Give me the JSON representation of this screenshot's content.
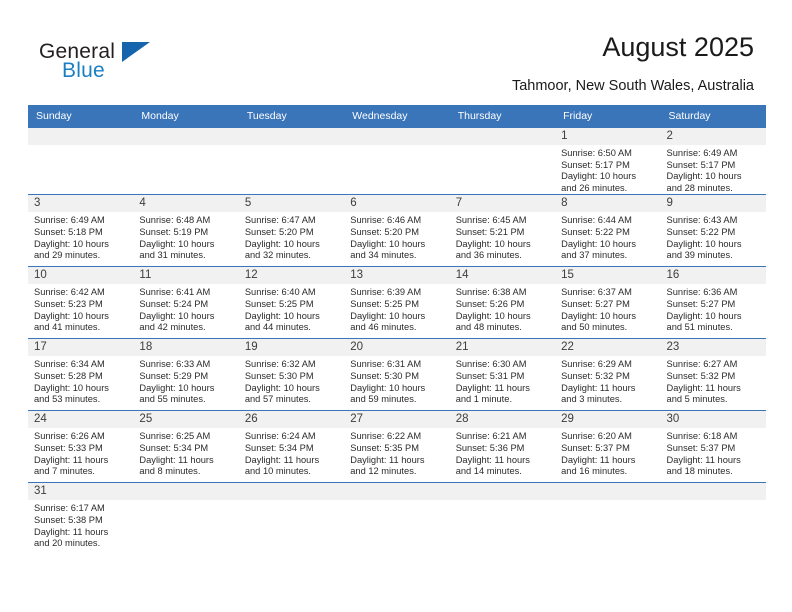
{
  "logo": {
    "word_one": "General",
    "word_two": "Blue",
    "triangle_color": "#1664ab",
    "blue_color": "#1b7fc4"
  },
  "header": {
    "title": "August 2025",
    "subtitle": "Tahmoor, New South Wales, Australia"
  },
  "theme": {
    "header_blue": "#3a75ba",
    "daynum_band": "#f1f1f1",
    "text": "#2b2b2b"
  },
  "calendar": {
    "weekday_headers": [
      "Sunday",
      "Monday",
      "Tuesday",
      "Wednesday",
      "Thursday",
      "Friday",
      "Saturday"
    ],
    "weeks": [
      [
        {
          "day": "",
          "lines": []
        },
        {
          "day": "",
          "lines": []
        },
        {
          "day": "",
          "lines": []
        },
        {
          "day": "",
          "lines": []
        },
        {
          "day": "",
          "lines": []
        },
        {
          "day": "1",
          "lines": [
            "Sunrise: 6:50 AM",
            "Sunset: 5:17 PM",
            "Daylight: 10 hours",
            "and 26 minutes."
          ]
        },
        {
          "day": "2",
          "lines": [
            "Sunrise: 6:49 AM",
            "Sunset: 5:17 PM",
            "Daylight: 10 hours",
            "and 28 minutes."
          ]
        }
      ],
      [
        {
          "day": "3",
          "lines": [
            "Sunrise: 6:49 AM",
            "Sunset: 5:18 PM",
            "Daylight: 10 hours",
            "and 29 minutes."
          ]
        },
        {
          "day": "4",
          "lines": [
            "Sunrise: 6:48 AM",
            "Sunset: 5:19 PM",
            "Daylight: 10 hours",
            "and 31 minutes."
          ]
        },
        {
          "day": "5",
          "lines": [
            "Sunrise: 6:47 AM",
            "Sunset: 5:20 PM",
            "Daylight: 10 hours",
            "and 32 minutes."
          ]
        },
        {
          "day": "6",
          "lines": [
            "Sunrise: 6:46 AM",
            "Sunset: 5:20 PM",
            "Daylight: 10 hours",
            "and 34 minutes."
          ]
        },
        {
          "day": "7",
          "lines": [
            "Sunrise: 6:45 AM",
            "Sunset: 5:21 PM",
            "Daylight: 10 hours",
            "and 36 minutes."
          ]
        },
        {
          "day": "8",
          "lines": [
            "Sunrise: 6:44 AM",
            "Sunset: 5:22 PM",
            "Daylight: 10 hours",
            "and 37 minutes."
          ]
        },
        {
          "day": "9",
          "lines": [
            "Sunrise: 6:43 AM",
            "Sunset: 5:22 PM",
            "Daylight: 10 hours",
            "and 39 minutes."
          ]
        }
      ],
      [
        {
          "day": "10",
          "lines": [
            "Sunrise: 6:42 AM",
            "Sunset: 5:23 PM",
            "Daylight: 10 hours",
            "and 41 minutes."
          ]
        },
        {
          "day": "11",
          "lines": [
            "Sunrise: 6:41 AM",
            "Sunset: 5:24 PM",
            "Daylight: 10 hours",
            "and 42 minutes."
          ]
        },
        {
          "day": "12",
          "lines": [
            "Sunrise: 6:40 AM",
            "Sunset: 5:25 PM",
            "Daylight: 10 hours",
            "and 44 minutes."
          ]
        },
        {
          "day": "13",
          "lines": [
            "Sunrise: 6:39 AM",
            "Sunset: 5:25 PM",
            "Daylight: 10 hours",
            "and 46 minutes."
          ]
        },
        {
          "day": "14",
          "lines": [
            "Sunrise: 6:38 AM",
            "Sunset: 5:26 PM",
            "Daylight: 10 hours",
            "and 48 minutes."
          ]
        },
        {
          "day": "15",
          "lines": [
            "Sunrise: 6:37 AM",
            "Sunset: 5:27 PM",
            "Daylight: 10 hours",
            "and 50 minutes."
          ]
        },
        {
          "day": "16",
          "lines": [
            "Sunrise: 6:36 AM",
            "Sunset: 5:27 PM",
            "Daylight: 10 hours",
            "and 51 minutes."
          ]
        }
      ],
      [
        {
          "day": "17",
          "lines": [
            "Sunrise: 6:34 AM",
            "Sunset: 5:28 PM",
            "Daylight: 10 hours",
            "and 53 minutes."
          ]
        },
        {
          "day": "18",
          "lines": [
            "Sunrise: 6:33 AM",
            "Sunset: 5:29 PM",
            "Daylight: 10 hours",
            "and 55 minutes."
          ]
        },
        {
          "day": "19",
          "lines": [
            "Sunrise: 6:32 AM",
            "Sunset: 5:30 PM",
            "Daylight: 10 hours",
            "and 57 minutes."
          ]
        },
        {
          "day": "20",
          "lines": [
            "Sunrise: 6:31 AM",
            "Sunset: 5:30 PM",
            "Daylight: 10 hours",
            "and 59 minutes."
          ]
        },
        {
          "day": "21",
          "lines": [
            "Sunrise: 6:30 AM",
            "Sunset: 5:31 PM",
            "Daylight: 11 hours",
            "and 1 minute."
          ]
        },
        {
          "day": "22",
          "lines": [
            "Sunrise: 6:29 AM",
            "Sunset: 5:32 PM",
            "Daylight: 11 hours",
            "and 3 minutes."
          ]
        },
        {
          "day": "23",
          "lines": [
            "Sunrise: 6:27 AM",
            "Sunset: 5:32 PM",
            "Daylight: 11 hours",
            "and 5 minutes."
          ]
        }
      ],
      [
        {
          "day": "24",
          "lines": [
            "Sunrise: 6:26 AM",
            "Sunset: 5:33 PM",
            "Daylight: 11 hours",
            "and 7 minutes."
          ]
        },
        {
          "day": "25",
          "lines": [
            "Sunrise: 6:25 AM",
            "Sunset: 5:34 PM",
            "Daylight: 11 hours",
            "and 8 minutes."
          ]
        },
        {
          "day": "26",
          "lines": [
            "Sunrise: 6:24 AM",
            "Sunset: 5:34 PM",
            "Daylight: 11 hours",
            "and 10 minutes."
          ]
        },
        {
          "day": "27",
          "lines": [
            "Sunrise: 6:22 AM",
            "Sunset: 5:35 PM",
            "Daylight: 11 hours",
            "and 12 minutes."
          ]
        },
        {
          "day": "28",
          "lines": [
            "Sunrise: 6:21 AM",
            "Sunset: 5:36 PM",
            "Daylight: 11 hours",
            "and 14 minutes."
          ]
        },
        {
          "day": "29",
          "lines": [
            "Sunrise: 6:20 AM",
            "Sunset: 5:37 PM",
            "Daylight: 11 hours",
            "and 16 minutes."
          ]
        },
        {
          "day": "30",
          "lines": [
            "Sunrise: 6:18 AM",
            "Sunset: 5:37 PM",
            "Daylight: 11 hours",
            "and 18 minutes."
          ]
        }
      ],
      [
        {
          "day": "31",
          "lines": [
            "Sunrise: 6:17 AM",
            "Sunset: 5:38 PM",
            "Daylight: 11 hours",
            "and 20 minutes."
          ]
        },
        {
          "day": "",
          "lines": []
        },
        {
          "day": "",
          "lines": []
        },
        {
          "day": "",
          "lines": []
        },
        {
          "day": "",
          "lines": []
        },
        {
          "day": "",
          "lines": []
        },
        {
          "day": "",
          "lines": []
        }
      ]
    ]
  }
}
